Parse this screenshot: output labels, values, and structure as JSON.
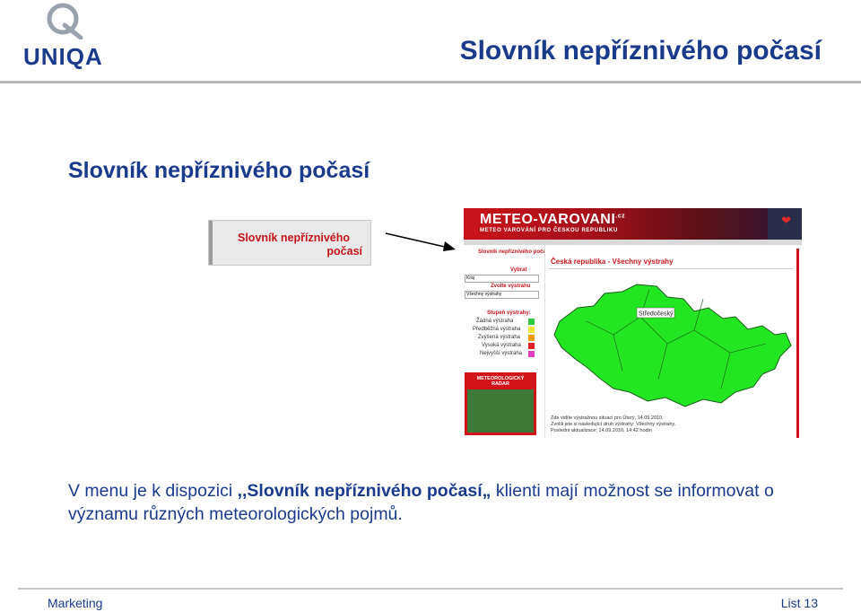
{
  "header": {
    "logo_text": "UNIQA",
    "title": "Slovník nepříznivého počasí"
  },
  "slide": {
    "heading": "Slovník nepříznivého počasí"
  },
  "menu_crop": {
    "line1": "Slovník nepříznivého",
    "line2": "počasí"
  },
  "screenshot": {
    "brand": "METEO-VAROVANI",
    "brand_suffix": ".cz",
    "brand_sub": "METEO VAROVÁNÍ PRO ČESKOU REPUBLIKU",
    "side_menu_title": "Slovník nepříznivého počasí",
    "select_label": "Vybrat",
    "select_value": "Kraj",
    "alerts_label": "Zvolte výstrahu",
    "alerts_value": "Všechny výstrahy",
    "levels_title": "Stupeň výstrahy:",
    "levels": [
      {
        "label": "Žádná výstraha",
        "color": "#2ecc40"
      },
      {
        "label": "Předběžná výstraha",
        "color": "#f5e63a"
      },
      {
        "label": "Zvýšená výstraha",
        "color": "#f39c12"
      },
      {
        "label": "Vysoká výstraha",
        "color": "#e02020"
      },
      {
        "label": "Nejvyšší výstraha",
        "color": "#e040c0"
      }
    ],
    "radar_title": "METEOROLOGICKÝ RADAR",
    "main_title": "Česká republika - Všechny výstrahy",
    "map_label": "Středočeský",
    "map_color": "#22e622",
    "footer_line1": "Zde vidíte výstražnou situaci pro Úterý, 14.09.2010.",
    "footer_line2": "Zvolili jste si následující druh výstrahy: Všechny výstrahy.",
    "footer_line3": "Poslední aktualizace: 14.09.2010, 14:42 hodin"
  },
  "body": {
    "prefix": "V menu je k dispozici ",
    "highlight": ",,Slovník nepříznivého počasí„",
    "suffix": " klienti mají možnost se informovat o významu různých meteorologických pojmů."
  },
  "footer": {
    "left": "Marketing",
    "right": "List 13"
  },
  "colors": {
    "brand_blue": "#1a3a8c",
    "accent_red": "#c4151c"
  }
}
